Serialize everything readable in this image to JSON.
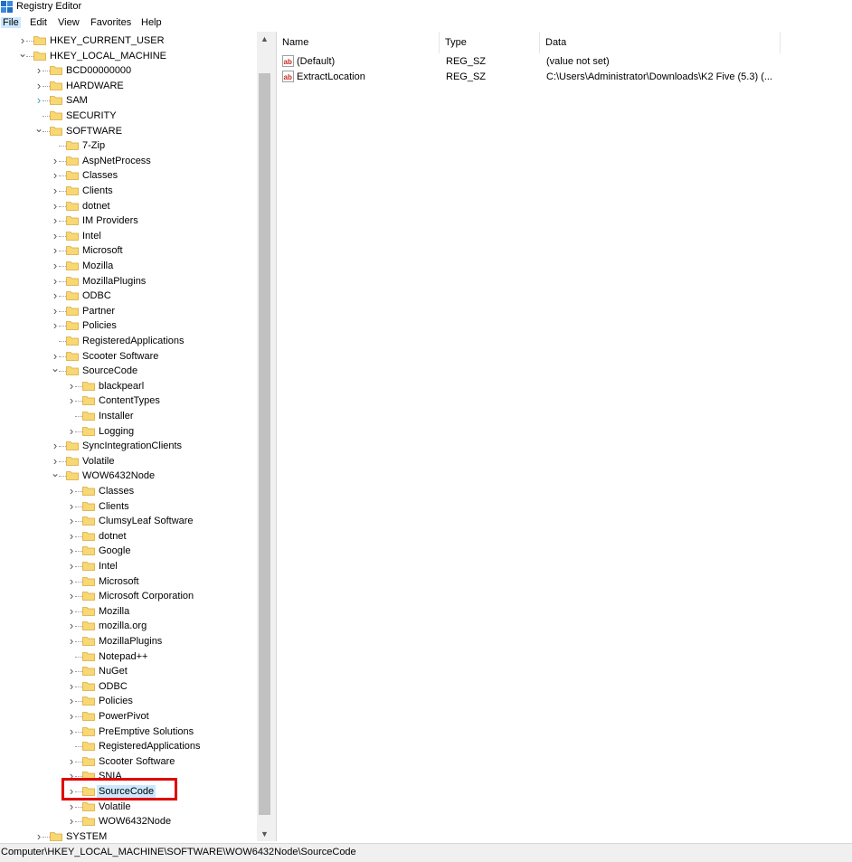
{
  "window": {
    "title": "Registry Editor"
  },
  "menu": [
    {
      "label": "File",
      "active": true
    },
    {
      "label": "Edit",
      "active": false
    },
    {
      "label": "View",
      "active": false
    },
    {
      "label": "Favorites",
      "active": false
    },
    {
      "label": "Help",
      "active": false
    }
  ],
  "tree": [
    {
      "label": "HKEY_CURRENT_USER",
      "level": 1,
      "expander": "closed"
    },
    {
      "label": "HKEY_LOCAL_MACHINE",
      "level": 1,
      "expander": "open"
    },
    {
      "label": "BCD00000000",
      "level": 2,
      "expander": "closed"
    },
    {
      "label": "HARDWARE",
      "level": 2,
      "expander": "closed"
    },
    {
      "label": "SAM",
      "level": 2,
      "expander": "closed-teal"
    },
    {
      "label": "SECURITY",
      "level": 2,
      "expander": "none"
    },
    {
      "label": "SOFTWARE",
      "level": 2,
      "expander": "open"
    },
    {
      "label": "7-Zip",
      "level": 3,
      "expander": "none"
    },
    {
      "label": "AspNetProcess",
      "level": 3,
      "expander": "closed"
    },
    {
      "label": "Classes",
      "level": 3,
      "expander": "closed"
    },
    {
      "label": "Clients",
      "level": 3,
      "expander": "closed"
    },
    {
      "label": "dotnet",
      "level": 3,
      "expander": "closed"
    },
    {
      "label": "IM Providers",
      "level": 3,
      "expander": "closed"
    },
    {
      "label": "Intel",
      "level": 3,
      "expander": "closed"
    },
    {
      "label": "Microsoft",
      "level": 3,
      "expander": "closed"
    },
    {
      "label": "Mozilla",
      "level": 3,
      "expander": "closed"
    },
    {
      "label": "MozillaPlugins",
      "level": 3,
      "expander": "closed"
    },
    {
      "label": "ODBC",
      "level": 3,
      "expander": "closed"
    },
    {
      "label": "Partner",
      "level": 3,
      "expander": "closed"
    },
    {
      "label": "Policies",
      "level": 3,
      "expander": "closed"
    },
    {
      "label": "RegisteredApplications",
      "level": 3,
      "expander": "none"
    },
    {
      "label": "Scooter Software",
      "level": 3,
      "expander": "closed"
    },
    {
      "label": "SourceCode",
      "level": 3,
      "expander": "open"
    },
    {
      "label": "blackpearl",
      "level": 4,
      "expander": "closed"
    },
    {
      "label": "ContentTypes",
      "level": 4,
      "expander": "closed"
    },
    {
      "label": "Installer",
      "level": 4,
      "expander": "none"
    },
    {
      "label": "Logging",
      "level": 4,
      "expander": "closed"
    },
    {
      "label": "SyncIntegrationClients",
      "level": 3,
      "expander": "closed"
    },
    {
      "label": "Volatile",
      "level": 3,
      "expander": "closed"
    },
    {
      "label": "WOW6432Node",
      "level": 3,
      "expander": "open"
    },
    {
      "label": "Classes",
      "level": 4,
      "expander": "closed"
    },
    {
      "label": "Clients",
      "level": 4,
      "expander": "closed"
    },
    {
      "label": "ClumsyLeaf Software",
      "level": 4,
      "expander": "closed"
    },
    {
      "label": "dotnet",
      "level": 4,
      "expander": "closed"
    },
    {
      "label": "Google",
      "level": 4,
      "expander": "closed"
    },
    {
      "label": "Intel",
      "level": 4,
      "expander": "closed"
    },
    {
      "label": "Microsoft",
      "level": 4,
      "expander": "closed"
    },
    {
      "label": "Microsoft Corporation",
      "level": 4,
      "expander": "closed"
    },
    {
      "label": "Mozilla",
      "level": 4,
      "expander": "closed"
    },
    {
      "label": "mozilla.org",
      "level": 4,
      "expander": "closed"
    },
    {
      "label": "MozillaPlugins",
      "level": 4,
      "expander": "closed"
    },
    {
      "label": "Notepad++",
      "level": 4,
      "expander": "none"
    },
    {
      "label": "NuGet",
      "level": 4,
      "expander": "closed"
    },
    {
      "label": "ODBC",
      "level": 4,
      "expander": "closed"
    },
    {
      "label": "Policies",
      "level": 4,
      "expander": "closed"
    },
    {
      "label": "PowerPivot",
      "level": 4,
      "expander": "closed"
    },
    {
      "label": "PreEmptive Solutions",
      "level": 4,
      "expander": "closed"
    },
    {
      "label": "RegisteredApplications",
      "level": 4,
      "expander": "none"
    },
    {
      "label": "Scooter Software",
      "level": 4,
      "expander": "closed"
    },
    {
      "label": "SNIA",
      "level": 4,
      "expander": "closed"
    },
    {
      "label": "SourceCode",
      "level": 4,
      "expander": "closed",
      "selected": true
    },
    {
      "label": "Volatile",
      "level": 4,
      "expander": "closed"
    },
    {
      "label": "WOW6432Node",
      "level": 4,
      "expander": "closed"
    },
    {
      "label": "SYSTEM",
      "level": 2,
      "expander": "closed"
    }
  ],
  "list": {
    "headers": [
      {
        "label": "Name"
      },
      {
        "label": "Type"
      },
      {
        "label": "Data"
      }
    ],
    "rows": [
      {
        "name": "(Default)",
        "type": "REG_SZ",
        "data": "(value not set)",
        "icon": "ab-string-icon"
      },
      {
        "name": "ExtractLocation",
        "type": "REG_SZ",
        "data": "C:\\Users\\Administrator\\Downloads\\K2 Five (5.3) (...",
        "icon": "ab-string-icon"
      }
    ]
  },
  "status": {
    "path": "Computer\\HKEY_LOCAL_MACHINE\\SOFTWARE\\WOW6432Node\\SourceCode"
  },
  "colors": {
    "selection": "#cce8ff",
    "folder": "#f8d775",
    "folder_edge": "#d9a93a",
    "highlight": "#e00000",
    "ab_red": "#c42b1c"
  }
}
